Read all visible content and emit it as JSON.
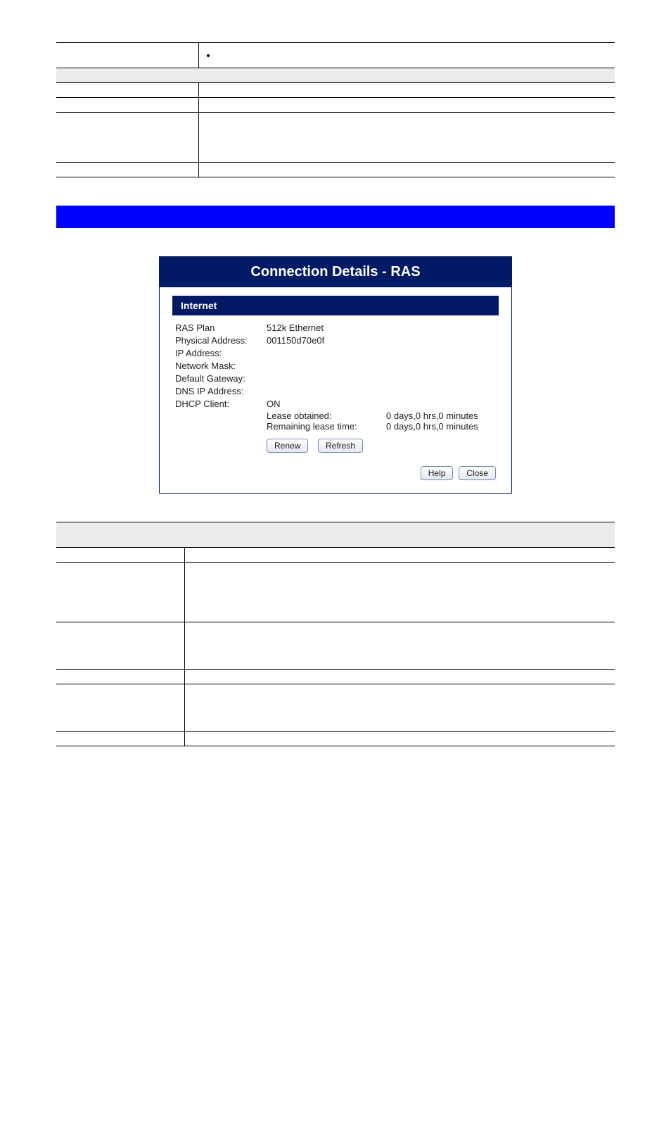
{
  "top_table": {
    "bullet_row": {
      "label": "",
      "bullet": ""
    },
    "section_header": "",
    "rows": [
      {
        "label": "",
        "value": ""
      },
      {
        "label": "",
        "value": ""
      },
      {
        "label": "",
        "value": "",
        "tall": true
      },
      {
        "label": "",
        "value": ""
      }
    ]
  },
  "blue_bar": {
    "text": ""
  },
  "conn": {
    "title": "Connection Details - RAS",
    "section": "Internet",
    "fields": [
      {
        "label": "RAS Plan",
        "value": "512k Ethernet"
      },
      {
        "label": "Physical Address:",
        "value": "001150d70e0f"
      },
      {
        "label": "IP Address:",
        "value": ""
      },
      {
        "label": "Network Mask:",
        "value": ""
      },
      {
        "label": "Default Gateway:",
        "value": ""
      },
      {
        "label": "DNS IP Address:",
        "value": ""
      }
    ],
    "dhcp": {
      "label": "DHCP Client:",
      "status": "ON",
      "lease_obtained_label": "Lease obtained:",
      "lease_obtained": "0 days,0 hrs,0 minutes",
      "remaining_label": "Remaining lease time:",
      "remaining": "0 days,0 hrs,0 minutes"
    },
    "buttons": {
      "renew": "Renew",
      "refresh": "Refresh",
      "help": "Help",
      "close": "Close"
    }
  },
  "bottom_table": {
    "section_header": "",
    "rows": [
      {
        "label": "",
        "value": "",
        "cls": ""
      },
      {
        "label": "",
        "value": "",
        "cls": "tall"
      },
      {
        "label": "",
        "value": "",
        "cls": "med"
      },
      {
        "label": "",
        "value": "",
        "cls": ""
      },
      {
        "label": "",
        "value": "",
        "cls": "med"
      },
      {
        "label": "",
        "value": "",
        "cls": ""
      }
    ]
  }
}
